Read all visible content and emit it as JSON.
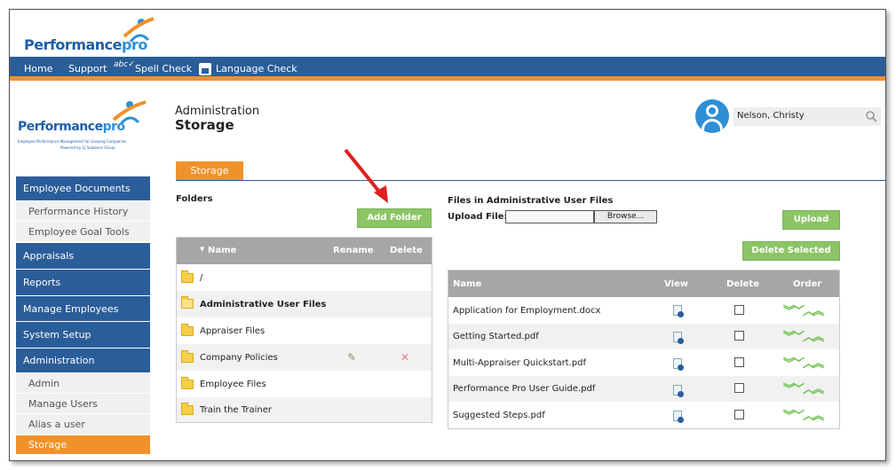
{
  "header": {
    "logo_main": "Performance",
    "logo_pro": "pro"
  },
  "topnav": {
    "items": [
      "Home",
      "Support",
      "Spell Check",
      "Language Check"
    ],
    "abc_icon_text": "abc"
  },
  "sidebar": {
    "logo_main": "Performance",
    "logo_pro": "pro",
    "logo_tagline": "Employee Performance Management for Growing Companies",
    "logo_powered": "Powered by CJ Solutions Group",
    "items": [
      {
        "label": "Employee Documents",
        "type": "main"
      },
      {
        "label": "Performance History",
        "type": "sub"
      },
      {
        "label": "Employee Goal Tools",
        "type": "sub"
      },
      {
        "label": "Appraisals",
        "type": "main"
      },
      {
        "label": "Reports",
        "type": "main"
      },
      {
        "label": "Manage Employees",
        "type": "main"
      },
      {
        "label": "System Setup",
        "type": "main"
      },
      {
        "label": "Administration",
        "type": "main"
      },
      {
        "label": "Admin",
        "type": "sub"
      },
      {
        "label": "Manage Users",
        "type": "sub"
      },
      {
        "label": "Alias a user",
        "type": "sub"
      },
      {
        "label": "Storage",
        "type": "sub-active"
      }
    ]
  },
  "page": {
    "breadcrumb": "Administration",
    "title": "Storage",
    "user_name": "Nelson, Christy",
    "tab": "Storage"
  },
  "folders": {
    "heading": "Folders",
    "add_button": "Add Folder",
    "columns": [
      "Name",
      "Rename",
      "Delete"
    ],
    "rows": [
      {
        "name": "/",
        "bold": false,
        "edit": false
      },
      {
        "name": "Administrative User Files",
        "bold": true,
        "edit": false
      },
      {
        "name": "Appraiser Files",
        "bold": false,
        "edit": false
      },
      {
        "name": "Company Policies",
        "bold": false,
        "edit": true
      },
      {
        "name": "Employee Files",
        "bold": false,
        "edit": false
      },
      {
        "name": "Train the Trainer",
        "bold": false,
        "edit": false
      }
    ]
  },
  "files": {
    "heading": "Files in Administrative User Files",
    "upload_label": "Upload File:",
    "browse_button": "Browse...",
    "upload_button": "Upload",
    "delete_selected_button": "Delete Selected",
    "columns": [
      "Name",
      "View",
      "Delete",
      "Order"
    ],
    "rows": [
      "Application for Employment.docx",
      "Getting Started.pdf",
      "Multi-Appraiser Quickstart.pdf",
      "Performance Pro User Guide.pdf",
      "Suggested Steps.pdf"
    ]
  },
  "colors": {
    "nav_blue": "#2b5d99",
    "accent_orange": "#f0922b",
    "button_green": "#8cc565",
    "annotation_arrow": "#e02020"
  }
}
